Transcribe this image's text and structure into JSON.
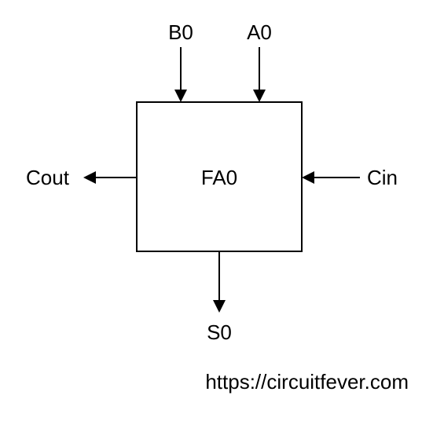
{
  "block": {
    "name": "FA0"
  },
  "inputs": {
    "top_left": "B0",
    "top_right": "A0",
    "right": "Cin"
  },
  "outputs": {
    "left": "Cout",
    "bottom": "S0"
  },
  "credit": "https://circuitfever.com"
}
